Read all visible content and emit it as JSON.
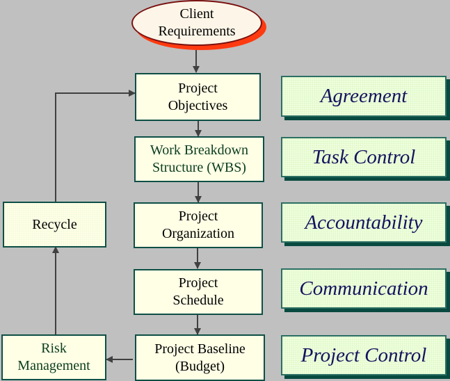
{
  "diagram": {
    "start": {
      "lines": [
        "Client",
        "Requirements"
      ]
    },
    "process_steps": [
      {
        "lines": [
          "Project",
          "Objectives"
        ]
      },
      {
        "lines": [
          "Work Breakdown",
          "Structure (WBS)"
        ]
      },
      {
        "lines": [
          "Project",
          "Organization"
        ]
      },
      {
        "lines": [
          "Project",
          "Schedule"
        ]
      },
      {
        "lines": [
          "Project Baseline",
          "(Budget)"
        ]
      }
    ],
    "feedback": {
      "recycle": {
        "lines": [
          "Recycle"
        ]
      },
      "risk": {
        "lines": [
          "Risk",
          "Management"
        ]
      }
    },
    "outcomes": [
      "Agreement",
      "Task Control",
      "Accountability",
      "Communication",
      "Project Control"
    ],
    "colors": {
      "background": "#c0c0c0",
      "box_fill": "#ffffe6",
      "box_border": "#0d4f45",
      "outcome_text": "#13135e",
      "ellipse_shadow": "#ff3a10",
      "arrow": "#404040"
    }
  }
}
